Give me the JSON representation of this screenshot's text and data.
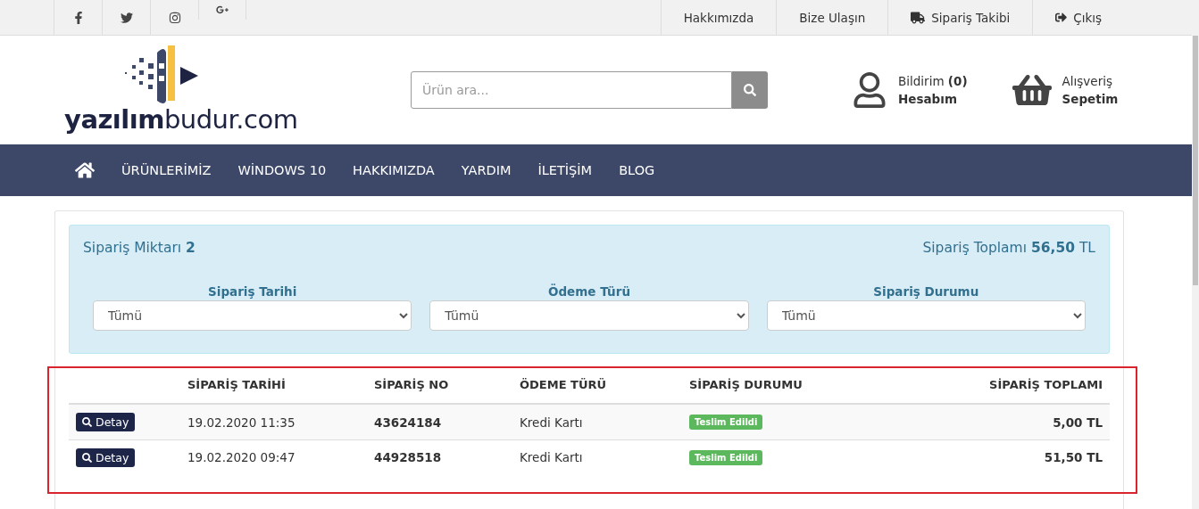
{
  "top_bar": {
    "social": [
      {
        "kind": "facebook"
      },
      {
        "kind": "twitter"
      },
      {
        "kind": "instagram"
      },
      {
        "kind": "googleplus"
      }
    ],
    "links": [
      {
        "kind": "plain",
        "label": "Hakkımızda"
      },
      {
        "kind": "plain",
        "label": "Bize Ulaşın"
      },
      {
        "kind": "tracking",
        "label": "Sipariş Takibi"
      },
      {
        "kind": "logout",
        "label": "Çıkış"
      }
    ]
  },
  "header": {
    "logo": "**yazılım**budur.com",
    "search": {
      "placeholder": "Ürün ara..."
    },
    "account": {
      "line1": "Bildirim **(0)**",
      "line2": "Hesabım"
    },
    "cart": {
      "line1": "Alışveriş",
      "line2": "Sepetim"
    }
  },
  "nav": [
    "ÜRÜNLERİMİZ",
    "WİNDOWS 10",
    "HAKKIMIZDA",
    "YARDIM",
    "İLETİŞİM",
    "BLOG"
  ],
  "summary": {
    "count": "Sipariş Miktarı **2**",
    "total": "Sipariş Toplamı **56,50** TL"
  },
  "filters": [
    {
      "label": "Sipariş Tarihi",
      "value": "Tümü"
    },
    {
      "label": "Ödeme Türü",
      "value": "Tümü"
    },
    {
      "label": "Sipariş Durumu",
      "value": "Tümü"
    }
  ],
  "table": {
    "highlighted": true,
    "columns": [
      "SİPARİŞ TARİHİ",
      "SİPARİŞ NO",
      "ÖDEME TÜRÜ",
      "SİPARİŞ DURUMU",
      "SİPARİŞ TOPLAMI"
    ],
    "rows": [
      {
        "button": "Detay",
        "date": "19.02.2020 11:35",
        "number": "43624184",
        "payment": "Kredi Kartı",
        "status": "Teslim Edildi",
        "total": "5,00 TL"
      },
      {
        "button": "Detay",
        "date": "19.02.2020 09:47",
        "number": "44928518",
        "payment": "Kredi Kartı",
        "status": "Teslim Edildi",
        "total": "51,50 TL"
      }
    ]
  }
}
